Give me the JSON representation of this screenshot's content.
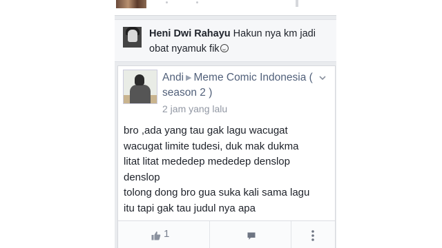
{
  "comment": {
    "author": "Heni Dwi Rahayu",
    "text": "Hakun nya km jadi obat nyamuk fik"
  },
  "post": {
    "author": "Andi",
    "group": "Meme Comic Indonesia ( season 2 )",
    "time": "2 jam yang lalu",
    "lines": [
      "bro ,ada yang tau gak lagu wacugat",
      "wacugat limite tudesi, duk mak dukma",
      "litat litat mededep mededep denslop",
      "denslop",
      "tolong dong bro gua suka kali sama lagu",
      "itu tapi gak tau judul nya apa"
    ],
    "like_count": "1"
  },
  "icons": {
    "like": "thumbs-up-icon",
    "comment": "comment-bubble-icon",
    "menu": "vertical-dots-icon",
    "chevron": "chevron-down-icon",
    "emoji": "smiley-icon"
  },
  "colors": {
    "author_link": "#51607a",
    "muted": "#9197a3",
    "background": "#e9ebee"
  }
}
